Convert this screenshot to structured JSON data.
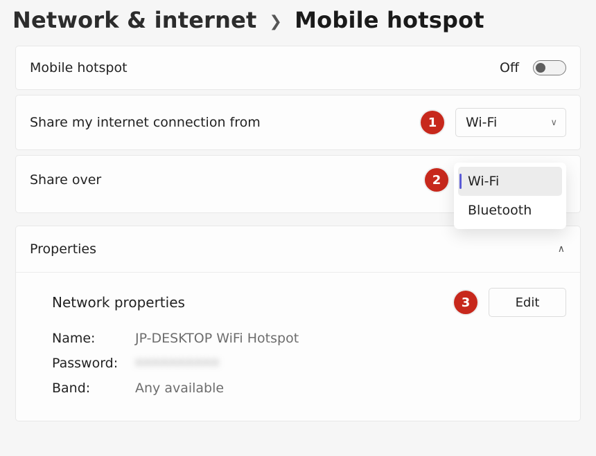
{
  "breadcrumb": {
    "parent": "Network & internet",
    "current": "Mobile hotspot"
  },
  "hotspot_toggle": {
    "label": "Mobile hotspot",
    "state_text": "Off",
    "value": false
  },
  "share_from": {
    "label": "Share my internet connection from",
    "selected": "Wi-Fi"
  },
  "share_over": {
    "label": "Share over",
    "selected": "Wi-Fi",
    "options": [
      "Wi-Fi",
      "Bluetooth"
    ]
  },
  "properties": {
    "title": "Properties",
    "section_title": "Network properties",
    "edit_label": "Edit",
    "name_key": "Name:",
    "name_value": "JP-DESKTOP WiFi Hotspot",
    "password_key": "Password:",
    "password_value": "••••••••••",
    "band_key": "Band:",
    "band_value": "Any available"
  },
  "markers": {
    "one": "1",
    "two": "2",
    "three": "3"
  }
}
